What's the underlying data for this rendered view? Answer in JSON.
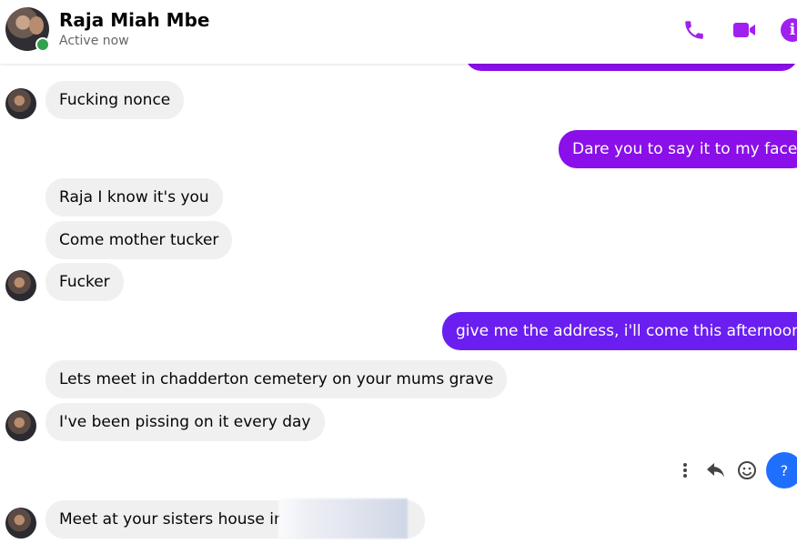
{
  "header": {
    "contact_name": "Raja Miah Mbe",
    "status": "Active now",
    "icons": {
      "call": "phone-icon",
      "video": "video-camera-icon",
      "info": "info-icon"
    },
    "info_glyph": "i",
    "accent_color": "#a020f0"
  },
  "messages": [
    {
      "side": "in",
      "text": "Fucking nonce"
    },
    {
      "side": "out",
      "text": "Dare you to say it to my face"
    },
    {
      "side": "in",
      "text": "Raja I know it's you"
    },
    {
      "side": "in",
      "text": "Come mother tucker"
    },
    {
      "side": "in",
      "text": "Fucker"
    },
    {
      "side": "out",
      "text": "give me the address, i'll come this afternoon"
    },
    {
      "side": "in",
      "text": "Lets meet in chadderton cemetery on your mums grave"
    },
    {
      "side": "in",
      "text": "I've been pissing on it every day"
    },
    {
      "side": "in",
      "text": "Meet at your sisters house in"
    }
  ],
  "message_actions": {
    "more": "more-vertical-icon",
    "reply": "reply-icon",
    "react": "smiley-icon",
    "help_label": "?"
  },
  "colors": {
    "outgoing_bubble": "#8a0fe8",
    "outgoing_bubble_alt": "#6a1ff0",
    "incoming_bubble": "#f0f0f0",
    "online": "#31a24c",
    "help_button": "#1f6fff"
  }
}
